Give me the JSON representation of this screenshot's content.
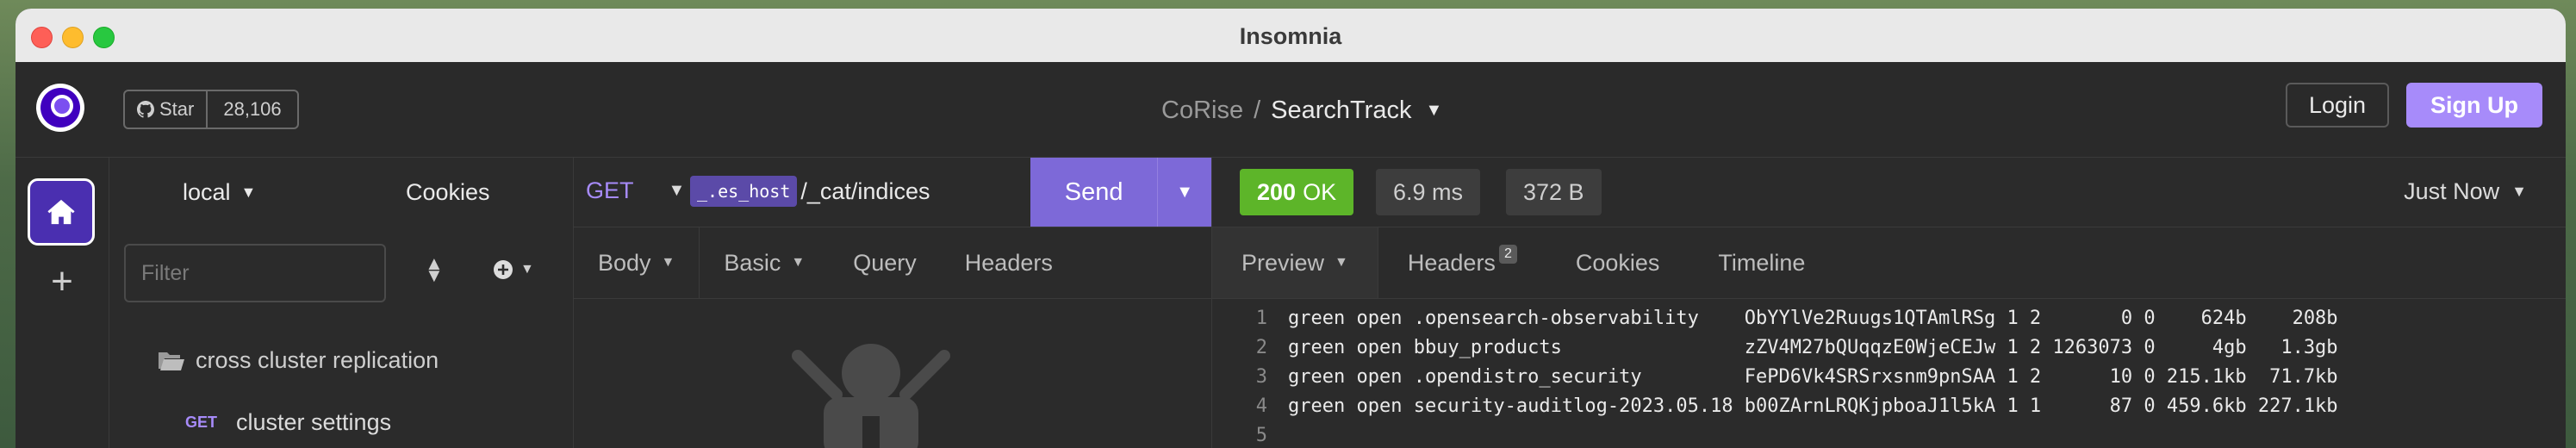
{
  "window": {
    "title": "Insomnia"
  },
  "header": {
    "github": {
      "star_label": "Star",
      "star_count": "28,106"
    },
    "breadcrumb": {
      "project": "CoRise",
      "separator": "/",
      "collection": "SearchTrack"
    },
    "login_label": "Login",
    "signup_label": "Sign Up"
  },
  "sidebar": {
    "environment": "local",
    "cookies_label": "Cookies",
    "filter_placeholder": "Filter",
    "folder_name": "cross cluster replication",
    "request": {
      "method": "GET",
      "name": "cluster settings"
    }
  },
  "request": {
    "method": "GET",
    "url_tag": "_.es_host",
    "url_path": "/_cat/indices",
    "send_label": "Send",
    "tabs": [
      "Body",
      "Basic",
      "Query",
      "Headers"
    ]
  },
  "response": {
    "status_code": "200",
    "status_text": "OK",
    "time": "6.9 ms",
    "size": "372 B",
    "history_label": "Just Now",
    "tabs": {
      "preview": "Preview",
      "headers": "Headers",
      "headers_count": "2",
      "cookies": "Cookies",
      "timeline": "Timeline"
    },
    "lines": [
      {
        "n": "1",
        "text": "green open .opensearch-observability    ObYYlVe2Ruugs1QTAmlRSg 1 2       0 0    624b    208b"
      },
      {
        "n": "2",
        "text": "green open bbuy_products                zZV4M27bQUqqzE0WjeCEJw 1 2 1263073 0     4gb   1.3gb"
      },
      {
        "n": "3",
        "text": "green open .opendistro_security         FePD6Vk4SRSrxsnm9pnSAA 1 2      10 0 215.1kb  71.7kb"
      },
      {
        "n": "4",
        "text": "green open security-auditlog-2023.05.18 b00ZArnLRQKjpboaJ1l5kA 1 1      87 0 459.6kb 227.1kb"
      },
      {
        "n": "5",
        "text": ""
      }
    ]
  },
  "colors": {
    "accent": "#a78bfa",
    "send": "#7d69d8",
    "ok": "#5db529"
  }
}
